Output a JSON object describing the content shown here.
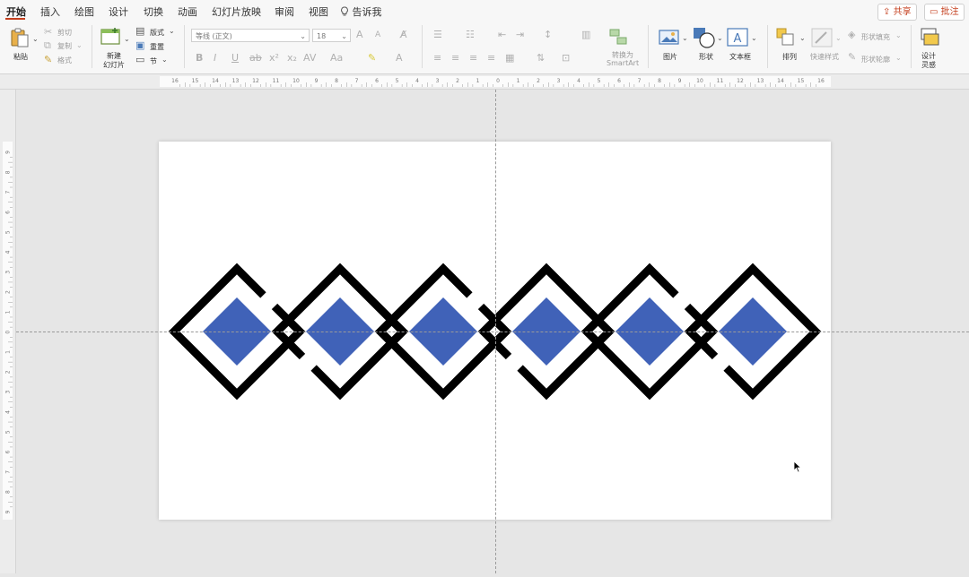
{
  "tabs": [
    {
      "key": "home",
      "label": "开始",
      "active": true
    },
    {
      "key": "insert",
      "label": "插入"
    },
    {
      "key": "draw",
      "label": "绘图"
    },
    {
      "key": "design",
      "label": "设计"
    },
    {
      "key": "transitions",
      "label": "切换"
    },
    {
      "key": "animations",
      "label": "动画"
    },
    {
      "key": "slideshow",
      "label": "幻灯片放映"
    },
    {
      "key": "review",
      "label": "审阅"
    },
    {
      "key": "view",
      "label": "视图"
    },
    {
      "key": "tellme",
      "label": "告诉我"
    }
  ],
  "top_actions": {
    "share": "共享",
    "comment": "批注"
  },
  "ribbon": {
    "paste": "粘贴",
    "cut": "剪切",
    "copy": "复制",
    "format": "格式",
    "new_slide_line1": "新建",
    "new_slide_line2": "幻灯片",
    "layout": "版式",
    "reset": "重置",
    "section": "节",
    "font_name": "等线 (正文)",
    "font_size": "18",
    "convert_line1": "转换为",
    "convert_line2": "SmartArt",
    "picture": "图片",
    "shapes": "形状",
    "textbox": "文本框",
    "arrange": "排列",
    "quick_styles": "快速样式",
    "shape_fill": "形状填充",
    "shape_outline": "形状轮廓",
    "design_ideas_line1": "设计",
    "design_ideas_line2": "灵感"
  },
  "rulers": {
    "horizontal": [
      "16",
      "15",
      "14",
      "13",
      "12",
      "11",
      "10",
      "9",
      "8",
      "7",
      "6",
      "5",
      "4",
      "3",
      "2",
      "1",
      "0",
      "1",
      "2",
      "3",
      "4",
      "5",
      "6",
      "7",
      "8",
      "9",
      "10",
      "11",
      "12",
      "13",
      "14",
      "15",
      "16"
    ],
    "vertical": [
      "9",
      "8",
      "7",
      "6",
      "5",
      "4",
      "3",
      "2",
      "1",
      "0",
      "1",
      "2",
      "3",
      "4",
      "5",
      "6",
      "7",
      "8",
      "9"
    ]
  },
  "slide": {
    "diamond_color": "#4062b8",
    "frame_color": "#000000",
    "pattern_count": 6
  },
  "colors": {
    "accent": "#c43e1c"
  }
}
